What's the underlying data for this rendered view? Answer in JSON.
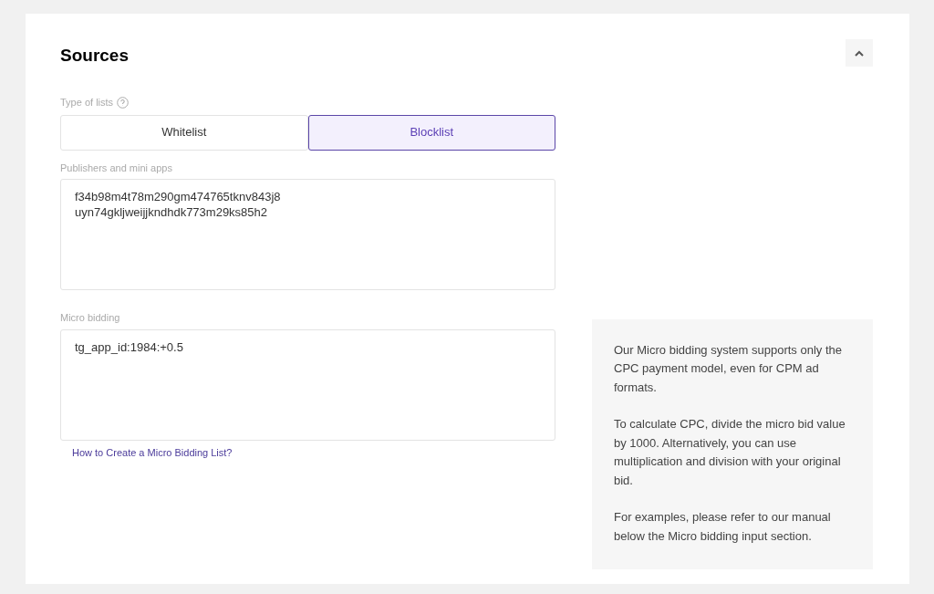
{
  "section": {
    "title": "Sources",
    "expanded": true
  },
  "list_type": {
    "label": "Type of lists",
    "options": [
      {
        "label": "Whitelist",
        "selected": false
      },
      {
        "label": "Blocklist",
        "selected": true
      }
    ]
  },
  "publishers": {
    "label": "Publishers and mini apps",
    "value": "f34b98m4t78m290gm474765tknv843j8\nuyn74gkljweijjkndhdk773m29ks85h2"
  },
  "micro_bidding": {
    "label": "Micro bidding",
    "value": "tg_app_id:1984:+0.5",
    "link": "How to Create a Micro Bidding List?"
  },
  "info": {
    "paragraphs": [
      "Our Micro bidding system supports only the CPC payment model, even for CPM ad formats.",
      "To calculate CPC, divide the micro bid value by 1000. Alternatively, you can use multiplication and division with your original bid.",
      "For examples, please refer to our manual below the Micro bidding input section."
    ]
  }
}
